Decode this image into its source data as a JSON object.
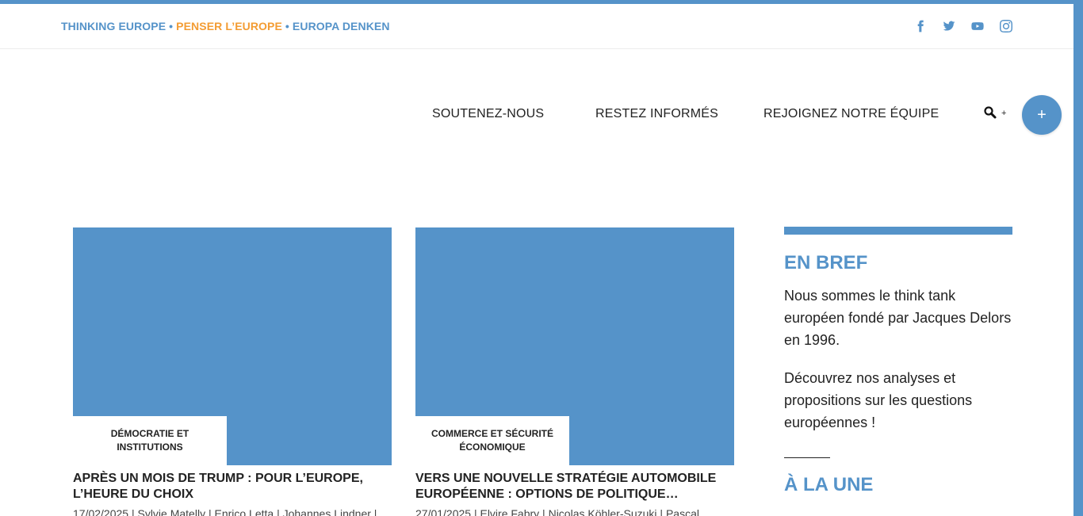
{
  "colors": {
    "accent": "#5593c9",
    "orange": "#f39c33"
  },
  "tagline": {
    "part1": "THINKING EUROPE",
    "sep1": " • ",
    "part2": "PENSER L’EUROPE",
    "sep2": " • ",
    "part3": "EUROPA DENKEN"
  },
  "social": [
    "facebook-icon",
    "twitter-icon",
    "youtube-icon",
    "instagram-icon"
  ],
  "nav": {
    "items": [
      "SOUTENEZ-NOUS",
      "RESTEZ INFORMÉS",
      "REJOIGNEZ NOTRE ÉQUIPE"
    ],
    "search_plus": "+",
    "fab": "+"
  },
  "articles": [
    {
      "category": "DÉMOCRATIE ET INSTITUTIONS",
      "title": "APRÈS UN MOIS DE TRUMP : POUR L’EUROPE, L’HEURE DU CHOIX",
      "meta": "17/02/2025 | Sylvie Matelly | Enrico Letta | Johannes Lindner |"
    },
    {
      "category": "COMMERCE ET SÉCURITÉ ÉCONOMIQUE",
      "title": "VERS UNE NOUVELLE STRATÉGIE AUTOMOBILE EUROPÉENNE : OPTIONS DE POLITIQUE…",
      "meta": "27/01/2025 | Elvire Fabry | Nicolas Köhler-Suzuki | Pascal"
    }
  ],
  "sidebar": {
    "heading": "EN BREF",
    "p1": "Nous sommes le think tank européen fondé par Jacques Delors en 1996.",
    "p2": "Découvrez nos analyses et propositions sur les questions européennes !",
    "heading2": "À LA UNE"
  }
}
